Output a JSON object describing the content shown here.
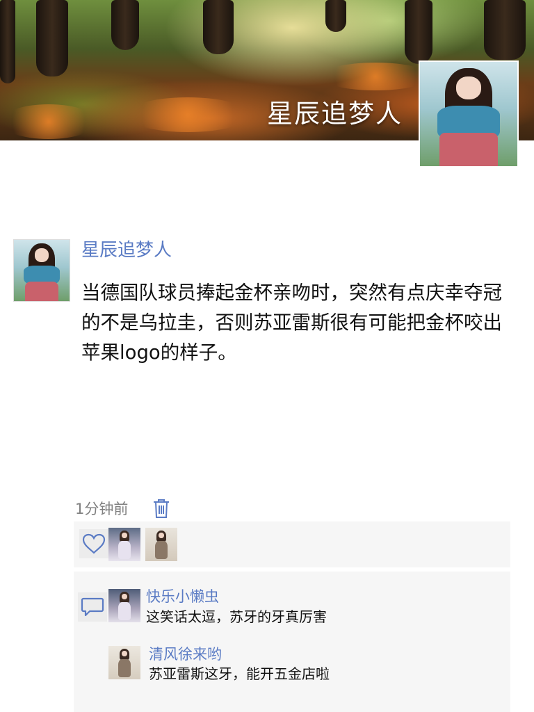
{
  "profile": {
    "cover_name": "星辰追梦人"
  },
  "post": {
    "author": "星辰追梦人",
    "text": "当德国队球员捧起金杯亲吻时，突然有点庆幸夺冠的不是乌拉圭，否则苏亚雷斯很有可能把金杯咬出苹果logo的样子。",
    "time": "1分钟前"
  },
  "likes": {
    "icon": "heart-outline-icon",
    "avatars": [
      "liker-avatar-1",
      "liker-avatar-2"
    ]
  },
  "comments": {
    "icon": "comment-bubble-icon",
    "items": [
      {
        "name": "快乐小懒虫",
        "text": "这笑话太逗，苏牙的牙真厉害"
      },
      {
        "name": "清风徐来哟",
        "text": "苏亚雷斯这牙，能开五金店啦"
      }
    ]
  },
  "colors": {
    "link_blue": "#5a7bc4",
    "panel_bg": "#f6f6f6",
    "meta_gray": "#808080"
  }
}
